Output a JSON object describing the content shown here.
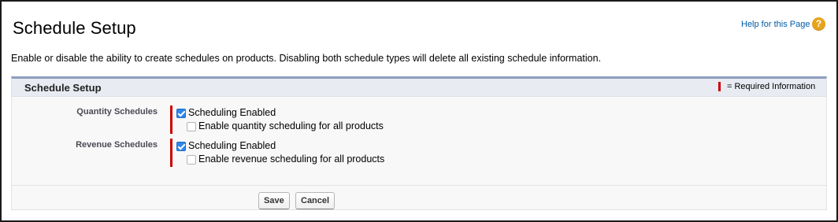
{
  "page": {
    "title": "Schedule Setup",
    "help_link": "Help for this Page",
    "help_icon": "?",
    "description": "Enable or disable the ability to create schedules on products. Disabling both schedule types will delete all existing schedule information."
  },
  "section": {
    "title": "Schedule Setup",
    "required_info": "= Required Information",
    "fields": [
      {
        "label": "Quantity Schedules",
        "enabled_label": "Scheduling Enabled",
        "enabled_checked": true,
        "all_products_label": "Enable quantity scheduling for all products",
        "all_products_checked": false
      },
      {
        "label": "Revenue Schedules",
        "enabled_label": "Scheduling Enabled",
        "enabled_checked": true,
        "all_products_label": "Enable revenue scheduling for all products",
        "all_products_checked": false
      }
    ]
  },
  "buttons": {
    "save": "Save",
    "cancel": "Cancel"
  },
  "colors": {
    "required": "#cc0000",
    "link": "#015ba7",
    "help_icon": "#e8a31d",
    "section_border": "#8e9dbe",
    "checkbox_checked": "#2f86e8"
  }
}
